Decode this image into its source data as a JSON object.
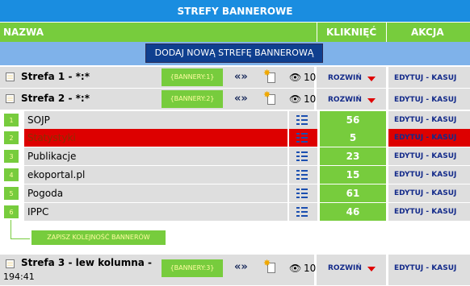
{
  "title": "STREFY BANNEROWE",
  "headers": {
    "name": "NAZWA",
    "clicked": "KLIKNIĘĆ",
    "action": "AKCJA"
  },
  "add_button": "DODAJ NOWĄ STREFĘ BANNEROWĄ",
  "zones": [
    {
      "name": "Strefa 1 - *:*",
      "name_suffix": "",
      "tag": "{BANNERY:1}",
      "views": "10",
      "expand": "ROZWIŃ",
      "edit": "EDYTUJ",
      "sep": " - ",
      "delete": "KASUJ"
    },
    {
      "name": "Strefa 2 - *:*",
      "name_suffix": "",
      "tag": "{BANNERY:2}",
      "views": "10",
      "expand": "ROZWIŃ",
      "edit": "EDYTUJ",
      "sep": " - ",
      "delete": "KASUJ"
    },
    {
      "name": "Strefa 3 - lew kolumna -",
      "name_suffix": "194:41",
      "tag": "{BANNERY:3}",
      "views": "10",
      "expand": "ROZWIŃ",
      "edit": "EDYTUJ",
      "sep": " - ",
      "delete": "KASUJ"
    }
  ],
  "banners": [
    {
      "num": "1",
      "name": "SOJP",
      "clicks": "56",
      "edit": "EDYTUJ",
      "sep": " - ",
      "delete": "KASUJ",
      "highlighted": false
    },
    {
      "num": "2",
      "name": "Statystyki",
      "clicks": "5",
      "edit": "EDYTUJ",
      "sep": " - ",
      "delete": "KASUJ",
      "highlighted": true
    },
    {
      "num": "3",
      "name": "Publikacje",
      "clicks": "23",
      "edit": "EDYTUJ",
      "sep": " - ",
      "delete": "KASUJ",
      "highlighted": false
    },
    {
      "num": "4",
      "name": "ekoportal.pl",
      "clicks": "15",
      "edit": "EDYTUJ",
      "sep": " - ",
      "delete": "KASUJ",
      "highlighted": false
    },
    {
      "num": "5",
      "name": "Pogoda",
      "clicks": "61",
      "edit": "EDYTUJ",
      "sep": " - ",
      "delete": "KASUJ",
      "highlighted": false
    },
    {
      "num": "6",
      "name": "IPPC",
      "clicks": "46",
      "edit": "EDYTUJ",
      "sep": " - ",
      "delete": "KASUJ",
      "highlighted": false
    }
  ],
  "save_button": "ZAPISZ KOLEJNOŚĆ BANNERÓW",
  "icons": {
    "zone": "checklist-icon",
    "move": "move-arrows-icon",
    "new": "new-document-icon",
    "views": "eye-icon",
    "expand": "arrow-down-icon",
    "order": "reorder-list-icon"
  },
  "colors": {
    "title_bg": "#1a8de0",
    "header_bg": "#77cc3d",
    "add_band_bg": "#7fb2ea",
    "add_button_bg": "#0f3f8f",
    "row_bg": "#dedede",
    "highlight": "#dd0000",
    "link": "#142b8a"
  }
}
